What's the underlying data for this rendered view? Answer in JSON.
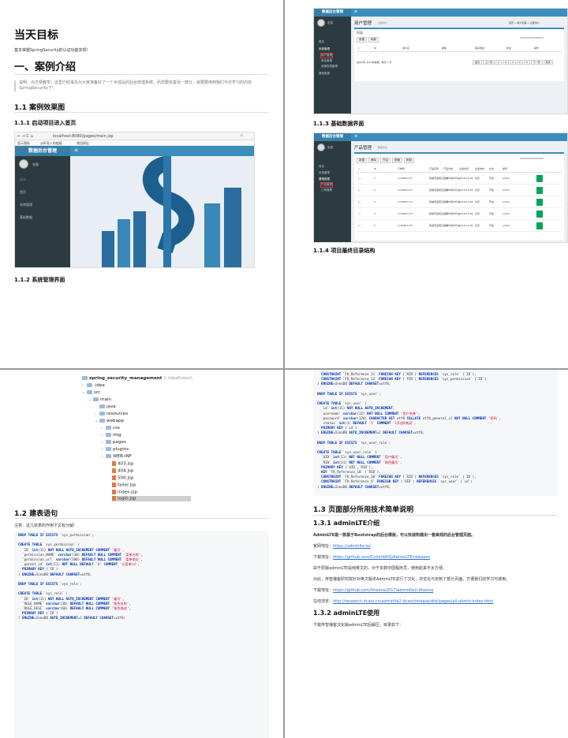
{
  "p1": {
    "title": "当天目标",
    "goal": "基本掌握SpringSecurity的认证功能实现!",
    "section": "一、案例介绍",
    "quote": "说明：为方便教学，这里已经事先为大家准备好了一个半成品的后台管理系统，而您要完善另一部分，就要要用到我们今天学习的内容SpringSecurity了!",
    "h_1_1": "1.1 案例效果图",
    "h_1_1_1": "1.1.1 启动项目进入首页",
    "browser_url": "localhost:8080/pages/main.jsp",
    "bookmarks": [
      "显示图标",
      "从IE导入的链接",
      "常用网址"
    ],
    "app_logo": "数据后台管理",
    "user_name": "张猿",
    "sidebar_items": [
      "菜单",
      "首页",
      "系统管理",
      "基础数据"
    ],
    "h_1_1_2": "1.1.2 系统管理界面"
  },
  "p2": {
    "app_logo": "数据后台管理",
    "user_name": "张猿",
    "sidebar_items": [
      "首页",
      "系统管理",
      "用户管理",
      "角色管理",
      "资源权限管理",
      "基础数据"
    ],
    "page_title": "用户管理",
    "page_sub": "全部用户",
    "breadcrumb": "首页 > 用户管理 > 全部用户",
    "panel_title": "列表",
    "buttons": [
      "新建",
      "刷新"
    ],
    "columns": [
      "ID",
      "用户名",
      "邮箱",
      "联系电话",
      "状态",
      "操作"
    ],
    "pager_text": "总共2页, 共14条数据。每页 1 条",
    "pager_links": [
      "首页",
      "上一页",
      "1",
      "2",
      "3",
      "4",
      "5",
      "下一页",
      "尾页"
    ],
    "h_1_1_3": "1.1.3 基础数据界面",
    "page_title2": "产品管理",
    "page_sub2": "数据列表",
    "buttons2": [
      "新建",
      "删除",
      "开启",
      "屏蔽",
      "刷新"
    ],
    "columns2": [
      "ID",
      "订单号",
      "产品名称",
      "产品价格",
      "出发时间",
      "出发城市",
      "状态",
      "编号"
    ],
    "rows2": [
      [
        "1",
        "1700651171",
        "夏威夷度假五日游一马尔代夫",
        "1000.0",
        "2018-10-08",
        "北京",
        "开启",
        "admin"
      ],
      [
        "2",
        "1700651172",
        "夏威夷度假五日游一马尔代夫",
        "1000.0",
        "2018-10-08",
        "北京",
        "开启",
        "admin"
      ],
      [
        "3",
        "1700651173",
        "夏威夷度假五日游一马尔代夫",
        "1000.0",
        "2018-10-08",
        "北京",
        "开启",
        "admin"
      ],
      [
        "4",
        "1700651174",
        "夏威夷度假五日游一马尔代夫",
        "1000.0",
        "2018-10-08",
        "北京",
        "开启",
        "admin"
      ],
      [
        "5",
        "1700651175",
        "夏威夷度假五日游一马尔代夫",
        "1000.0",
        "2018-10-08",
        "北京",
        "开启",
        "admin"
      ]
    ],
    "sidebar_items2": [
      "首页",
      "系统管理",
      "基础数据",
      "产品管理",
      "订单管理"
    ],
    "h_1_1_4": "1.1.4 项目最终目录结构"
  },
  "p3": {
    "tree_root": "spring_security_management",
    "tree_root_path": "C:\\IdeaProject\\",
    "tree": [
      ".idea",
      "src",
      "main",
      "java",
      "resources",
      "webapp",
      "css",
      "img",
      "pages",
      "plugins",
      "WEB-INF",
      "403.jsp",
      "404.jsp",
      "500.jsp",
      "failer.jsp",
      "index.jsp",
      "login.jsp"
    ],
    "h_1_2": "1.2 建表语句",
    "note": "注意：这几张表的作用下文有分解!",
    "code": [
      "DROP TABLE IF EXISTS `sys_permission`;",
      "",
      "CREATE TABLE `sys_permission` (",
      "  `ID` int(11) NOT NULL AUTO_INCREMENT COMMENT '编号',",
      "  `permission_NAME` varchar(30) DEFAULT NULL COMMENT '菜单名称',",
      "  `permission_url` varchar(100) DEFAULT NULL COMMENT '菜单地址',",
      "  `parent_id` int(11) NOT NULL DEFAULT '0' COMMENT '父菜单id',",
      "  PRIMARY KEY (`ID`)",
      ") ENGINE=InnoDB DEFAULT CHARSET=utf8;",
      "",
      "DROP TABLE IF EXISTS `sys_role`;",
      "",
      "CREATE TABLE `sys_role` (",
      "  `ID` int(11) NOT NULL AUTO_INCREMENT COMMENT '编号',",
      "  `ROLE_NAME` varchar(30) DEFAULT NULL COMMENT '角色名称',",
      "  `ROLE_DESC` varchar(60) DEFAULT NULL COMMENT '角色描述',",
      "  PRIMARY KEY (`ID`)",
      ") ENGINE=InnoDB AUTO_INCREMENT=2 DEFAULT CHARSET=utf8;"
    ]
  },
  "p4": {
    "code": [
      "  CONSTRAINT `FK_Reference_11` FOREIGN KEY (`RID`) REFERENCES `sys_role` (`ID`),",
      "  CONSTRAINT `FK_Reference_12` FOREIGN KEY (`PID`) REFERENCES `sys_permission` (`ID`)",
      ") ENGINE=InnoDB DEFAULT CHARSET=utf8;",
      "",
      "DROP TABLE IF EXISTS `sys_user`;",
      "",
      "CREATE TABLE `sys_user` (",
      "  `id` int(11) NOT NULL AUTO_INCREMENT,",
      "  `username` varchar(32) NOT NULL COMMENT '用户名称',",
      "  `password` varchar(120) CHARACTER SET utf8 COLLATE utf8_general_ci NOT NULL COMMENT '密码',",
      "  `status` int(1) DEFAULT '1' COMMENT '1开启0关闭',",
      "  PRIMARY KEY (`id`)",
      ") ENGINE=InnoDB AUTO_INCREMENT=2 DEFAULT CHARSET=utf8;",
      "",
      "DROP TABLE IF EXISTS `sys_user_role`;",
      "",
      "CREATE TABLE `sys_user_role` (",
      "  `UID` int(11) NOT NULL COMMENT '用户编号',",
      "  `RID` int(11) NOT NULL COMMENT '角色编号',",
      "  PRIMARY KEY (`UID`,`RID`),",
      "  KEY `FK_Reference_10` (`RID`),",
      "  CONSTRAINT `FK_Reference_10` FOREIGN KEY (`RID`) REFERENCES `sys_role` (`ID`),",
      "  CONSTRAINT `FK_Reference_9` FOREIGN KEY (`UID`) REFERENCES `sys_user` (`id`)",
      ") ENGINE=InnoDB DEFAULT CHARSET=utf8;"
    ],
    "h_1_3": "1.3 页面部分所用技术简单说明",
    "h_1_3_1": "1.3.1 adminLTE介绍",
    "intro": "AdminLTE是一款基于Bootstrap的后台模板，可以快速构建出一套美观的后台管理页面。",
    "official_label": "官网地址：",
    "official_url": "https://adminlte.io/",
    "download_label": "下载地址：",
    "download_url": "https://github.com/ColorlibHQ/AdminLTE/releases",
    "note1": "由于原版adminLTE是纯英文的，对于多数中国程序员，使用起来不太方便。",
    "note2": "对此，传智播客研究院针对英文版本AdminLTE进行了汉化，并优化与定制了部分页面，方便我们的学习与使用。",
    "download2_label": "下载地址：",
    "download2_url": "https://github.com/itheima2017/adminlte2-itheima",
    "browse_label": "在线浏览：",
    "browse_url": "http://research.itcast.cn/adminlte2-itcast/release/dist/pages/all-admin-index.html",
    "h_1_3_2": "1.3.2 adminLTE使用",
    "last": "下载传智播客汉化版adminLTE后解压，目录如下："
  }
}
